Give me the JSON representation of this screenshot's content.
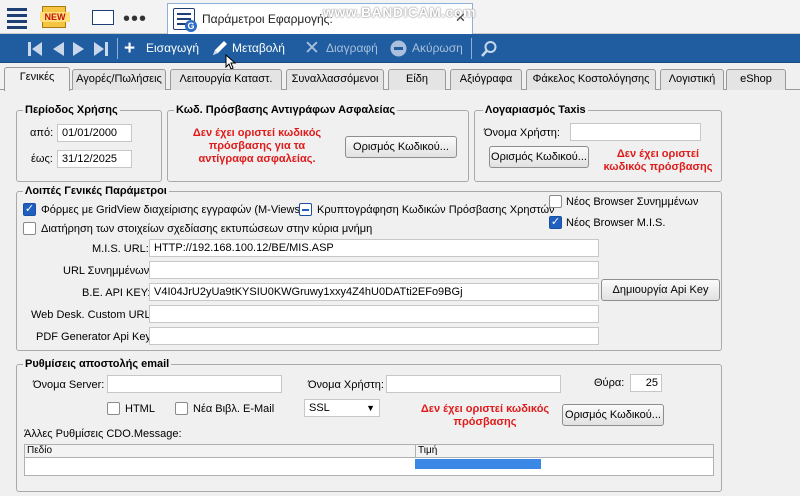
{
  "window": {
    "doc_tab_title": "Παράμετροι Εφαρμογής:",
    "close_glyph": "✕",
    "new_badge": "NEW",
    "watermark": "www.BANDICAM.com",
    "more_glyph": "•••"
  },
  "toolbar": {
    "insert": "Εισαγωγή",
    "edit": "Μεταβολή",
    "delete": "Διαγραφή",
    "cancel": "Ακύρωση"
  },
  "tabs": [
    "Γενικές",
    "Αγορές/Πωλήσεις",
    "Λειτουργία Καταστ.",
    "Συναλλασσόμενοι",
    "Είδη",
    "Αξιόγραφα",
    "Φάκελος Κοστολόγησης",
    "Λογιστική",
    "eShop"
  ],
  "period": {
    "legend": "Περίοδος Χρήσης",
    "from_label": "από:",
    "from_value": "01/01/2000",
    "to_label": "έως:",
    "to_value": "31/12/2025"
  },
  "backup": {
    "legend": "Κωδ. Πρόσβασης Αντιγράφων Ασφαλείας",
    "warning_1": "Δεν έχει οριστεί κωδικός",
    "warning_2": "πρόσβασης για τα",
    "warning_3": "αντίγραφα ασφαλείας.",
    "button": "Ορισμός Κωδικού..."
  },
  "taxis": {
    "legend": "Λογαριασμός Taxis",
    "user_label": "Όνομα Χρήστη:",
    "user_value": "",
    "button": "Ορισμός Κωδικού...",
    "warning_1": "Δεν έχει οριστεί",
    "warning_2": "κωδικός πρόσβασης"
  },
  "general": {
    "legend": "Λοιπές Γενικές Παράμετροι",
    "opt_gridview": "Φόρμες με GridView διαχείρισης εγγραφών (M-Views)",
    "opt_gridview_checked": true,
    "opt_encrypt": "Κρυπτογράφηση Κωδικών Πρόσβασης Χρηστών",
    "opt_encrypt_state": "indeterminate",
    "opt_keep_design": "Διατήρηση των στοιχείων σχεδίασης εκτυπώσεων στην κύρια μνήμη",
    "opt_keep_design_checked": false,
    "opt_browser_partners": "Νέος Browser Συνημμένων",
    "opt_browser_partners_checked": false,
    "opt_browser_mis": "Νέος Browser M.I.S.",
    "opt_browser_mis_checked": true,
    "mis_url_label": "M.I.S. URL:",
    "mis_url_value": "HTTP://192.168.100.12/BE/MIS.ASP",
    "attach_url_label": "URL Συνημμένων:",
    "attach_url_value": "",
    "api_key_label": "B.E. API KEY:",
    "api_key_value": "V4I04JrU2yUa9tKYSIU0KWGruwy1xxy4Z4hU0DATti2EFo9BGj",
    "api_key_button": "Δημιουργία Api Key",
    "webdesk_label": "Web Desk. Custom URL:",
    "webdesk_value": "",
    "pdf_label": "PDF Generator Api Key",
    "pdf_value": ""
  },
  "email": {
    "legend": "Ρυθμίσεις αποστολής email",
    "server_label": "Όνομα Server:",
    "server_value": "",
    "user_label": "Όνομα Χρήστη:",
    "user_value": "",
    "port_label": "Θύρα:",
    "port_value": "25",
    "html_label": "HTML",
    "html_checked": false,
    "newlib_label": "Νέα Βιβλ. E-Mail",
    "newlib_checked": false,
    "ssl_value": "SSL",
    "warning_1": "Δεν έχει οριστεί κωδικός",
    "warning_2": "πρόσβασης",
    "button": "Ορισμός Κωδικού...",
    "cdo_label": "Άλλες Ρυθμίσεις CDO.Message:",
    "grid_col_field": "Πεδίο",
    "grid_col_value": "Τιμή"
  }
}
